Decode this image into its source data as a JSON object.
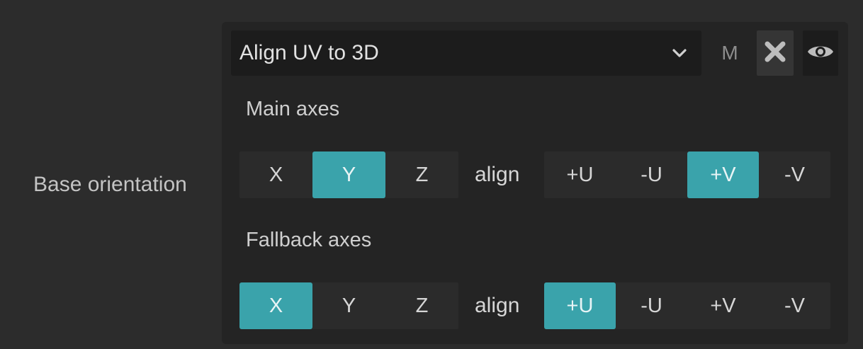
{
  "row_label": "Base orientation",
  "dropdown": {
    "value": "Align UV to 3D",
    "chevron_icon": "chevron-down-icon"
  },
  "header_buttons": {
    "m_label": "M",
    "clear_icon": "close-icon",
    "visibility_icon": "eye-icon"
  },
  "main_axes": {
    "label": "Main axes",
    "axes": [
      {
        "label": "X",
        "active": false
      },
      {
        "label": "Y",
        "active": true
      },
      {
        "label": "Z",
        "active": false
      }
    ],
    "align_label": "align",
    "directions": [
      {
        "label": "+U",
        "active": false
      },
      {
        "label": "-U",
        "active": false
      },
      {
        "label": "+V",
        "active": true
      },
      {
        "label": "-V",
        "active": false
      }
    ]
  },
  "fallback_axes": {
    "label": "Fallback axes",
    "axes": [
      {
        "label": "X",
        "active": true
      },
      {
        "label": "Y",
        "active": false
      },
      {
        "label": "Z",
        "active": false
      }
    ],
    "align_label": "align",
    "directions": [
      {
        "label": "+U",
        "active": true
      },
      {
        "label": "-U",
        "active": false
      },
      {
        "label": "+V",
        "active": false
      },
      {
        "label": "-V",
        "active": false
      }
    ]
  },
  "colors": {
    "accent": "#3aa3ab",
    "background": "#2c2c2c",
    "panel": "#242424"
  }
}
